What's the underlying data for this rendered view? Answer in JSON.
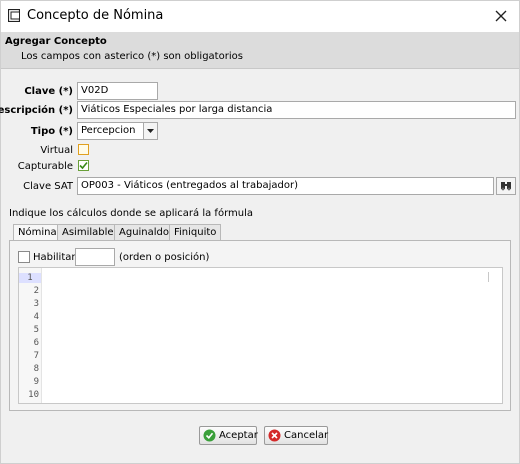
{
  "window": {
    "title": "Concepto de Nómina"
  },
  "header": {
    "title": "Agregar Concepto",
    "subtitle": "Los campos con asterico (*) son obligatorios"
  },
  "form": {
    "clave_label": "Clave (*)",
    "clave_value": "V02D",
    "descripcion_label": "Descripción (*)",
    "descripcion_value": "Viáticos Especiales por larga distancia",
    "tipo_label": "Tipo (*)",
    "tipo_value": "Percepcion",
    "virtual_label": "Virtual",
    "virtual_checked": false,
    "capturable_label": "Capturable",
    "capturable_checked": true,
    "clave_sat_label": "Clave SAT",
    "clave_sat_value": "OP003 - Viáticos (entregados al trabajador)"
  },
  "formula": {
    "instruction": "Indique los cálculos donde se aplicará la fórmula",
    "tabs": [
      "Nómina",
      "Asimilables",
      "Aguinaldo",
      "Finiquito"
    ],
    "active_tab": "Nómina",
    "habilitar_label": "Habilitar",
    "orden_value": "",
    "orden_hint": "(orden o posición)",
    "line_numbers": [
      "1",
      "2",
      "3",
      "4",
      "5",
      "6",
      "7",
      "8",
      "9",
      "10"
    ]
  },
  "buttons": {
    "accept": "Aceptar",
    "cancel": "Cancelar"
  },
  "colors": {
    "accept_icon": "#3aa03a",
    "cancel_icon": "#d42a2a"
  }
}
